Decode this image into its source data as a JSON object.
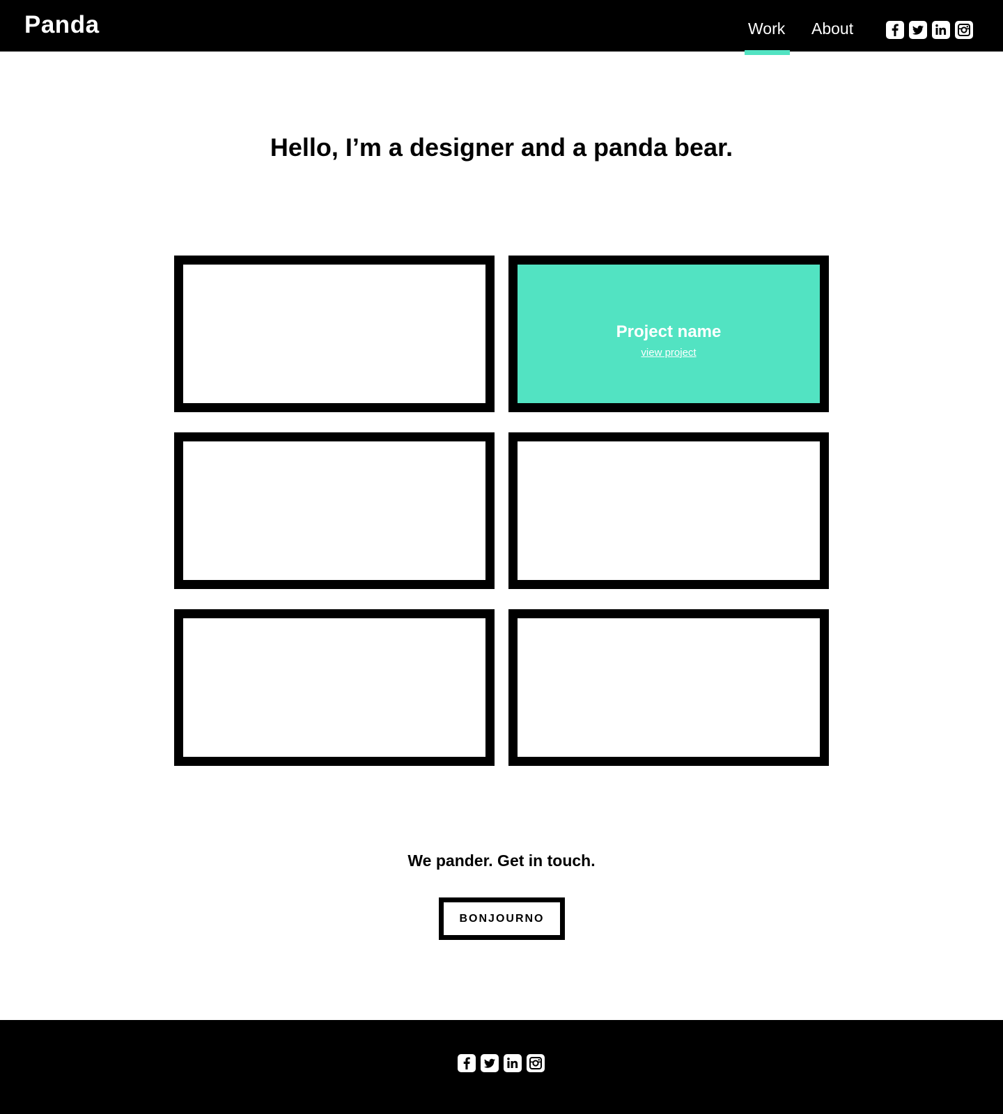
{
  "header": {
    "logo": "Panda",
    "nav": [
      {
        "label": "Work",
        "active": true
      },
      {
        "label": "About",
        "active": false
      }
    ],
    "social": [
      "facebook-icon",
      "twitter-icon",
      "linkedin-icon",
      "instagram-icon"
    ]
  },
  "hero": {
    "title": "Hello, I’m a designer and a panda bear."
  },
  "projects": [
    {
      "name": "",
      "link": "",
      "active": false
    },
    {
      "name": "Project name",
      "link": "view project",
      "active": true
    },
    {
      "name": "",
      "link": "",
      "active": false
    },
    {
      "name": "",
      "link": "",
      "active": false
    },
    {
      "name": "",
      "link": "",
      "active": false
    },
    {
      "name": "",
      "link": "",
      "active": false
    }
  ],
  "cta": {
    "text": "We pander. Get in touch.",
    "button": "BONJOURNO"
  },
  "footer": {
    "social": [
      "facebook-icon",
      "twitter-icon",
      "linkedin-icon",
      "instagram-icon"
    ]
  },
  "colors": {
    "accent": "#52e3c2",
    "dark": "#000000",
    "light": "#ffffff"
  }
}
